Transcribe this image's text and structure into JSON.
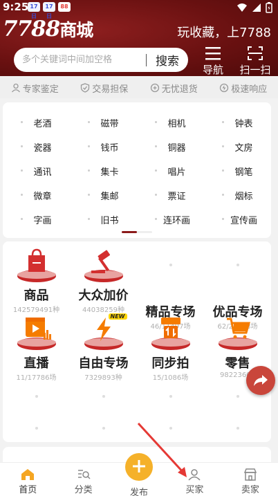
{
  "status": {
    "time": "9:25",
    "apps": [
      {
        "icon": "app-badge-icon",
        "text": "17日"
      },
      {
        "icon": "app-badge-icon",
        "text": "17日"
      },
      {
        "icon": "app-red-icon",
        "text": "88"
      }
    ]
  },
  "header": {
    "brand": "7788",
    "brand_suffix": "商城",
    "slogan": "玩收藏，上7788",
    "search_placeholder": "多个关键词中间加空格",
    "search_button": "搜索",
    "nav_label": "导航",
    "scan_label": "扫一扫"
  },
  "assurances": [
    {
      "icon": "person-icon",
      "label": "专家鉴定"
    },
    {
      "icon": "shield-icon",
      "label": "交易担保"
    },
    {
      "icon": "return-icon",
      "label": "无忧退货"
    },
    {
      "icon": "lightning-icon",
      "label": "极速响应"
    }
  ],
  "categories": [
    "老酒",
    "磁带",
    "相机",
    "钟表",
    "瓷器",
    "钱币",
    "铜器",
    "文房",
    "通讯",
    "集卡",
    "唱片",
    "钢笔",
    "微章",
    "集邮",
    "票证",
    "烟标",
    "字画",
    "旧书",
    "连环画",
    "宣传画"
  ],
  "features": [
    {
      "title": "商品",
      "sub": "142579491种",
      "icon": "bag-icon"
    },
    {
      "title": "大众加价",
      "sub": "44038259种",
      "icon": "gavel-icon"
    },
    {
      "title": "精品专场",
      "sub": "46/11497场",
      "icon": "placeholder"
    },
    {
      "title": "优品专场",
      "sub": "62/24348场",
      "icon": "placeholder"
    },
    {
      "title": "直播",
      "sub": "11/17786场",
      "icon": "video-icon"
    },
    {
      "title": "自由专场",
      "sub": "7329893种",
      "icon": "lightning-icon",
      "badge": "NEW"
    },
    {
      "title": "同步拍",
      "sub": "15/1086场",
      "icon": "sync-auction-icon"
    },
    {
      "title": "零售",
      "sub": "98223603",
      "icon": "cart-icon"
    }
  ],
  "tabs": [
    {
      "label": "首页",
      "icon": "home-icon",
      "active": true
    },
    {
      "label": "分类",
      "icon": "list-search-icon"
    },
    {
      "label": "发布",
      "icon": "plus-icon"
    },
    {
      "label": "买家",
      "icon": "user-icon"
    },
    {
      "label": "卖家",
      "icon": "shop-icon"
    }
  ],
  "colors": {
    "brand_red": "#7a1515",
    "accent_orange": "#f5b12a",
    "icon_red": "#c62828",
    "active_tab": "#f5a623"
  }
}
